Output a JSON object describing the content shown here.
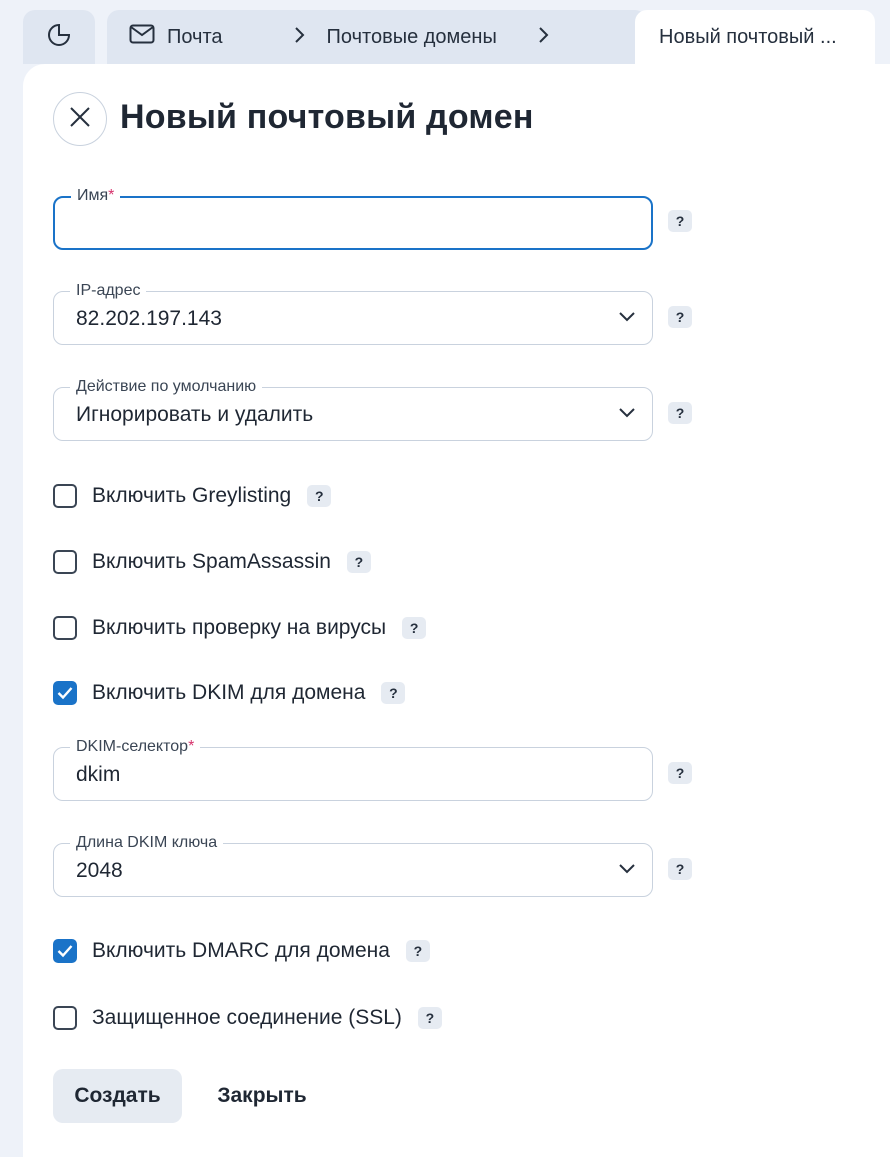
{
  "tabs": {
    "home_icon": "pie-chart-icon",
    "crumbs": [
      "Почта",
      "Почтовые домены"
    ],
    "active_label": "Новый почтовый ..."
  },
  "page": {
    "title": "Новый почтовый домен"
  },
  "fields": {
    "name": {
      "label": "Имя",
      "required_mark": "*",
      "value": ""
    },
    "ip": {
      "label": "IP-адрес",
      "value": "82.202.197.143"
    },
    "default_action": {
      "label": "Действие по умолчанию",
      "value": "Игнорировать и удалить"
    },
    "dkim_selector": {
      "label": "DKIM-селектор",
      "required_mark": "*",
      "value": "dkim"
    },
    "dkim_length": {
      "label": "Длина DKIM ключа",
      "value": "2048"
    }
  },
  "checkboxes": {
    "greylisting": {
      "label": "Включить Greylisting",
      "checked": false
    },
    "spamassassin": {
      "label": "Включить SpamAssassin",
      "checked": false
    },
    "antivirus": {
      "label": "Включить проверку на вирусы",
      "checked": false
    },
    "dkim": {
      "label": "Включить DKIM для домена",
      "checked": true
    },
    "dmarc": {
      "label": "Включить DMARC для домена",
      "checked": true
    },
    "ssl": {
      "label": "Защищенное соединение (SSL)",
      "checked": false
    }
  },
  "help_mark": "?",
  "buttons": {
    "create": "Создать",
    "close": "Закрыть"
  },
  "colors": {
    "accent": "#1a73c8",
    "required": "#d6336c",
    "background": "#eef2f9"
  }
}
